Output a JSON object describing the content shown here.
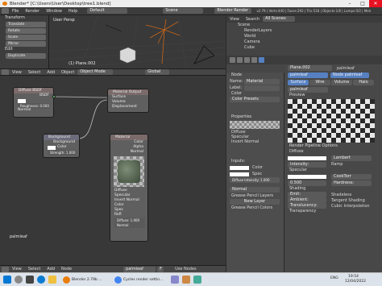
{
  "window": {
    "title": "Blender* [C:\\Users\\User\\Desktop\\tree1.blend]"
  },
  "infobar": {
    "menu": [
      "File",
      "Render",
      "Window",
      "Help"
    ],
    "layout": "Default",
    "scene": "Scene",
    "engine": "Blender Render",
    "stats": "v2.79 | Verts:440 | Faces:292 | Tris:518 | Objects:1/6 | Lamps:0/2 | Mem:3"
  },
  "toolshelf": {
    "title": "Transform",
    "buttons": [
      "Translate",
      "Rotate",
      "Scale",
      "Mirror"
    ],
    "edit_title": "Edit",
    "edit_buttons": [
      "Duplicate"
    ]
  },
  "viewport": {
    "view_label": "User Persp",
    "object_label": "(1) Plane.002"
  },
  "view3d_header": {
    "menus": [
      "View",
      "Select",
      "Add",
      "Object"
    ],
    "mode": "Object Mode",
    "orientation": "Global"
  },
  "nodes": {
    "diffuse": {
      "title": "Diffuse BSDF",
      "out": "BSDF",
      "color": "Color",
      "roughness": "Roughness: 0.000",
      "normal": "Normal"
    },
    "material_output": {
      "title": "Material Output",
      "inputs": [
        "Surface",
        "Volume",
        "Displacement"
      ]
    },
    "background": {
      "title": "Background",
      "out": "Background",
      "color": "Color",
      "strength": "Strength: 1.000"
    },
    "material": {
      "title": "Material",
      "outputs": [
        "Color",
        "Alpha",
        "Normal"
      ],
      "toggles": [
        "Diffuse",
        "Specular",
        "Invert Normal"
      ],
      "inputs": [
        "Color",
        "Spec",
        "Refl"
      ],
      "diffuse": "Diffuse: 1.000",
      "normal_label": "Normal"
    }
  },
  "node_editor": {
    "material_name": "palmleaf"
  },
  "node_header": {
    "menus": [
      "View",
      "Select",
      "Add",
      "Node"
    ],
    "material": "palmleaf",
    "slot": "F",
    "use_nodes": "Use Nodes"
  },
  "node_panel": {
    "section": "Node",
    "name_label": "Name:",
    "name_value": "Material",
    "label_label": "Label:",
    "color_section": "Color",
    "color_presets": "Color Presets",
    "properties_section": "Properties",
    "toggles": [
      "Diffuse",
      "Specular",
      "Invert Normal"
    ],
    "inputs_section": "Inputs:",
    "input_rows": [
      "Color",
      "Spec"
    ],
    "diffuse_intensity": "Diffuse Intensity: 1.000",
    "normal_label": "Normal",
    "grease_pencil_layers": "Grease Pencil Layers",
    "new_layer": "New Layer",
    "grease_pencil_colors": "Grease Pencil Colors"
  },
  "outliner": {
    "menus": [
      "View",
      "Search",
      "All Scenes"
    ],
    "items": [
      "Scene",
      "RenderLayers",
      "World",
      "Camera",
      "Cube"
    ]
  },
  "props_right": {
    "object": "Plane.002",
    "material": "palmleaf",
    "slot": "palmleaf",
    "node_material": "Node palmleaf",
    "tabs": [
      "Surface",
      "Wire",
      "Volume",
      "Halo"
    ],
    "preview_section": "Preview",
    "render_pipeline": "Render Pipeline Options",
    "diffuse_section": "Diffuse",
    "diffuse_shader": "Lambert",
    "intensity_label": "Intensity:",
    "intensity_value": "1.000",
    "ramp": "Ramp",
    "specular_section": "Specular",
    "spec_shader": "CookTorr",
    "spec_intensity": "0.500",
    "hardness": "Hardness:",
    "hardness_value": "50",
    "shading_section": "Shading",
    "emit": "Emit:",
    "emit_value": "0.00",
    "ambient": "Ambient:",
    "ambient_value": "1.000",
    "translucency": "Translucency:",
    "translucency_value": "0.000",
    "shadeless": "Shadeless",
    "tangent": "Tangent Shading",
    "cubic": "Cubic Interpolation",
    "transparency_section": "Transparency"
  },
  "taskbar": {
    "apps": [
      "Blender 2.79b ...",
      "Cycles render settin..."
    ],
    "tray": "ENG",
    "time": "19:54",
    "date": "12/04/2022"
  },
  "colors": {
    "accent": "#5680c2",
    "title_bg": "#eeeeee",
    "close": "#e81123"
  }
}
